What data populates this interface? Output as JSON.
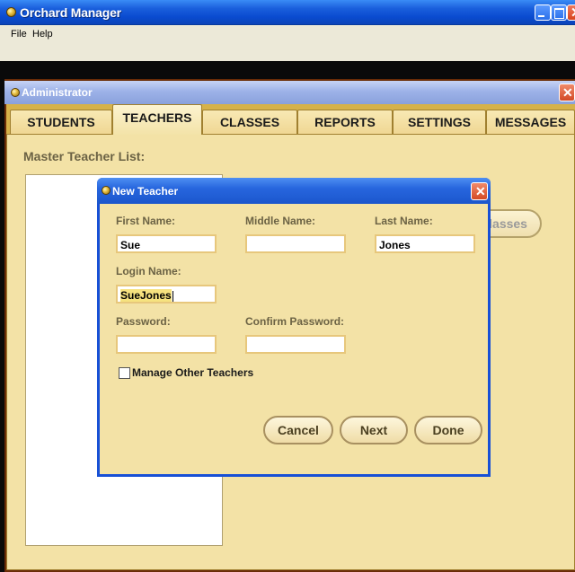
{
  "app": {
    "title": "Orchard Manager",
    "menu": {
      "file": "File",
      "help": "Help"
    }
  },
  "admin": {
    "title": "Administrator",
    "tabs": [
      {
        "label": "STUDENTS"
      },
      {
        "label": "TEACHERS",
        "active": true
      },
      {
        "label": "CLASSES"
      },
      {
        "label": "REPORTS"
      },
      {
        "label": "SETTINGS"
      },
      {
        "label": "MESSAGES"
      }
    ],
    "master_list_label": "Master Teacher List:",
    "classes_button": "Classes"
  },
  "dialog": {
    "title": "New Teacher",
    "first_name": {
      "label": "First Name:",
      "value": "Sue"
    },
    "middle_name": {
      "label": "Middle Name:",
      "value": ""
    },
    "last_name": {
      "label": "Last Name:",
      "value": "Jones"
    },
    "login_name": {
      "label": "Login Name:",
      "value": "SueJones"
    },
    "password": {
      "label": "Password:",
      "value": ""
    },
    "confirm_password": {
      "label": "Confirm Password:",
      "value": ""
    },
    "manage_other": {
      "label": "Manage Other Teachers",
      "checked": false
    },
    "buttons": {
      "cancel": "Cancel",
      "next": "Next",
      "done": "Done"
    }
  },
  "colors": {
    "xp_title_blue": "#0a4bd0",
    "panel_cream": "#f3e2a6",
    "tab_gold": "#d6b24a"
  }
}
